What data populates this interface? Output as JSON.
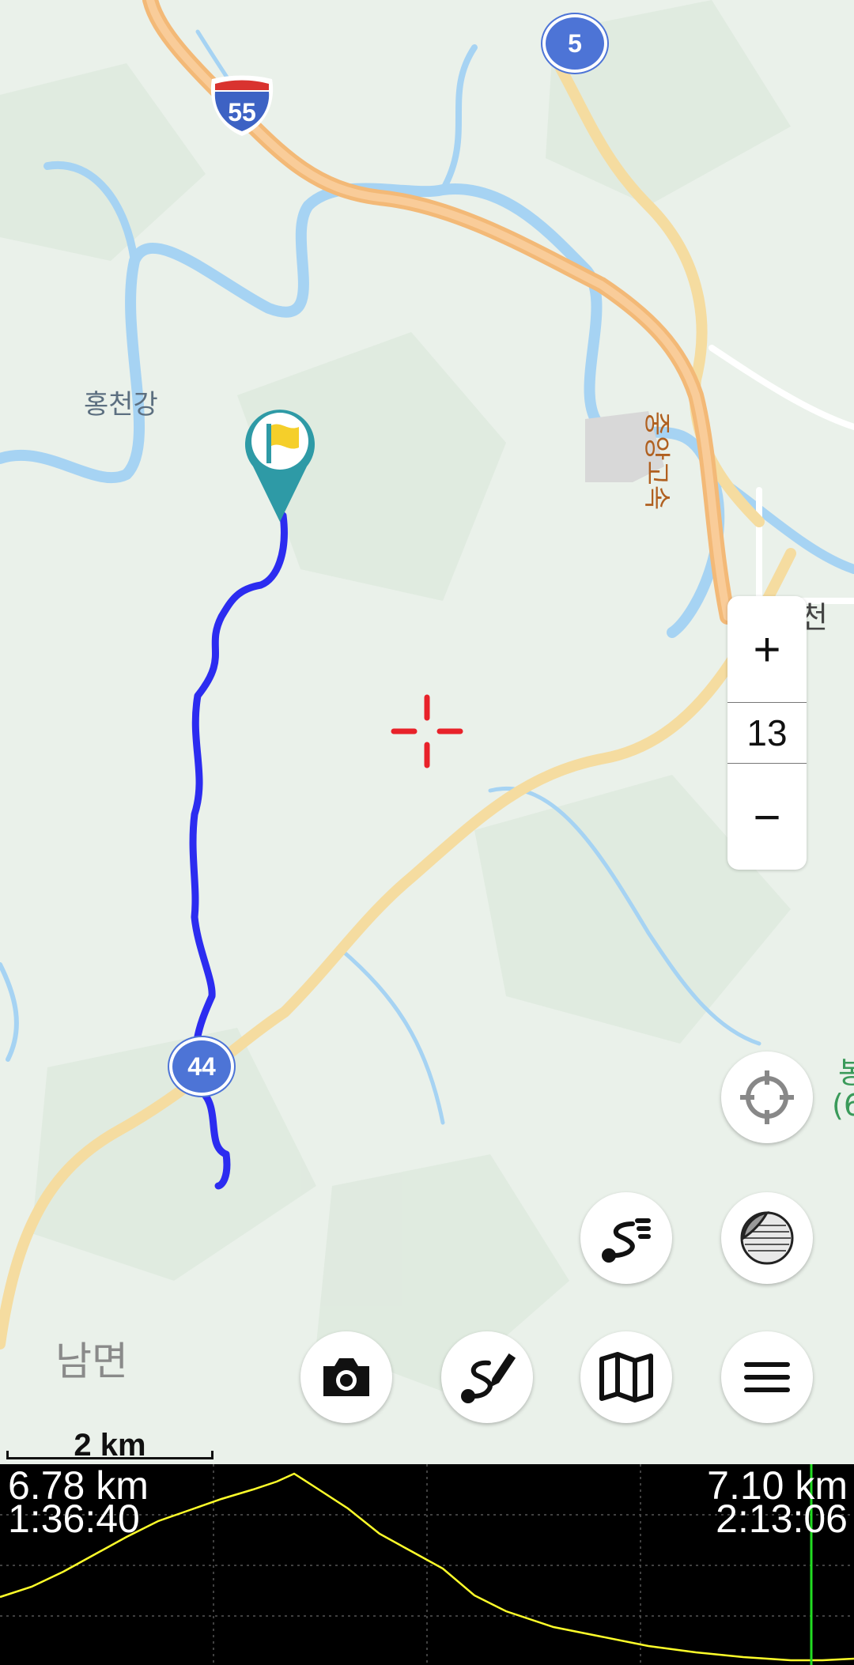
{
  "map": {
    "labels": {
      "river": "홍천강",
      "town_south": "남면",
      "expressway": "중앙고속",
      "town_east_partial": "천",
      "right_edge_partial": "봉",
      "right_edge_partial2": "(6"
    },
    "shields": {
      "interstate": "55",
      "route_5": "5",
      "route_44": "44"
    },
    "colors": {
      "track": "#2c2cf0",
      "marker": "#2e9aa6",
      "flag": "#f5cf2a",
      "crosshair": "#e8222a",
      "road_major": "#f4c27a",
      "road_minor": "#f9e2a0",
      "water": "#9fd0f2"
    }
  },
  "zoom": {
    "plus": "+",
    "level": "13",
    "minus": "−"
  },
  "buttons": {
    "locate": "crosshair-target-icon",
    "layers": "layers-icon",
    "track_list": "track-list-icon",
    "camera": "camera-icon",
    "draw_route": "draw-route-icon",
    "map_select": "map-icon",
    "menu": "menu-icon"
  },
  "scale": {
    "label": "2 km"
  },
  "profile": {
    "left_distance": "6.78 km",
    "left_time": "1:36:40",
    "right_distance": "7.10 km",
    "right_time": "2:13:06",
    "line_color": "#ffff2a",
    "cursor_color": "#22dd22"
  }
}
